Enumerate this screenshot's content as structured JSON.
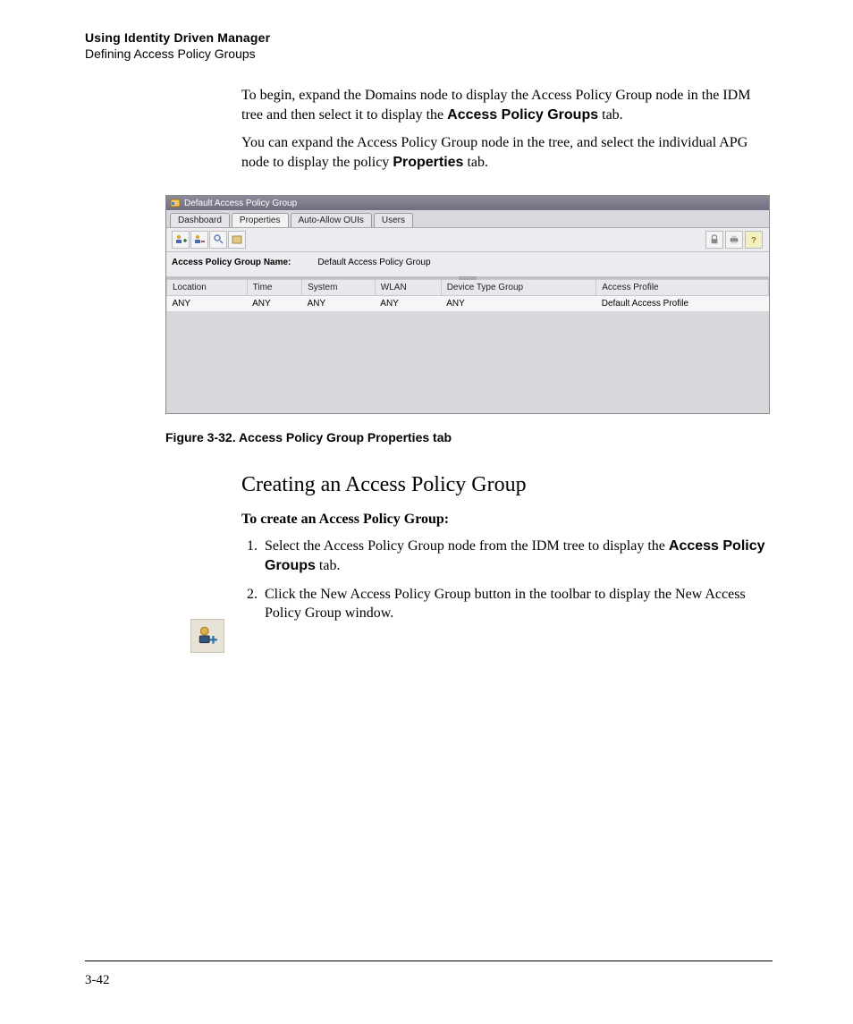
{
  "header": {
    "title": "Using Identity Driven Manager",
    "subtitle": "Defining Access Policy Groups"
  },
  "paras": {
    "p1_a": "To begin, expand the Domains node to display the Access Policy Group node in the IDM tree and then select it to display the ",
    "p1_bold": "Access Policy Groups",
    "p1_b": " tab.",
    "p2_a": "You can expand the Access Policy Group node in the tree, and select the individual APG node to display the policy ",
    "p2_bold": "Properties",
    "p2_b": " tab."
  },
  "screenshot": {
    "title": "Default Access Policy Group",
    "tabs": [
      "Dashboard",
      "Properties",
      "Auto-Allow OUIs",
      "Users"
    ],
    "active_tab_index": 1,
    "label_name": "Access Policy Group Name:",
    "label_value": "Default Access Policy Group",
    "cols": [
      "Location",
      "Time",
      "System",
      "WLAN",
      "Device Type Group",
      "Access Profile"
    ],
    "row": [
      "ANY",
      "ANY",
      "ANY",
      "ANY",
      "ANY",
      "Default Access Profile"
    ]
  },
  "figure_caption": "Figure 3-32. Access Policy Group Properties tab",
  "section_heading": "Creating an Access Policy Group",
  "procedure_intro": "To create an Access Policy Group:",
  "steps": {
    "s1_a": "Select the Access Policy Group node from the IDM tree to display the ",
    "s1_bold": "Access Policy Groups",
    "s1_b": " tab.",
    "s2": "Click the New Access Policy Group button in the toolbar to display the New Access Policy Group window."
  },
  "page_number": "3-42"
}
